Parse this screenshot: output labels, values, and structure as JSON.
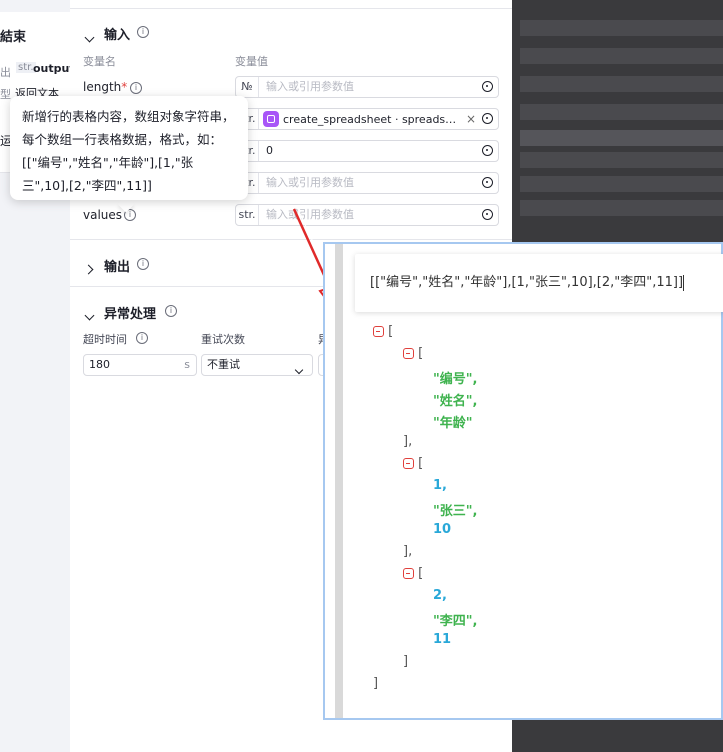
{
  "left_panel": {
    "title": "結束",
    "row1_prefix": "出",
    "row1_type": "str.",
    "row1_name": "output",
    "row2_prefix": "型",
    "row2_text": "返回文本",
    "row3_text": "运行"
  },
  "input_section": {
    "title": "输入",
    "col_name": "变量名",
    "col_value": "变量值",
    "rows": [
      {
        "name": "length",
        "required": "*",
        "type": "№",
        "placeholder": "输入或引用参数值",
        "value": ""
      },
      {
        "name": "",
        "type": "str.",
        "value": "",
        "chip": "create_spreadsheet · spreads…",
        "chip_close": "×"
      },
      {
        "name": "",
        "type": "str.",
        "value": "0"
      },
      {
        "name": "",
        "type": "str.",
        "placeholder": "输入或引用参数值"
      },
      {
        "name": "values",
        "type": "str.",
        "placeholder": "输入或引用参数值"
      }
    ]
  },
  "tooltip": {
    "text": "新增行的表格内容，数组对象字符串，每个数组一行表格数据，格式，如：[[\"编号\",\"姓名\",\"年龄\"],[1,\"张三\",10],[2,\"李四\",11]]"
  },
  "output_section": {
    "title": "输出"
  },
  "exception_section": {
    "title": "异常处理",
    "timeout_label": "超时时间",
    "timeout_value": "180",
    "timeout_unit": "s",
    "retry_label": "重试次数",
    "retry_value": "不重试",
    "third_label": "异"
  },
  "json_viewer": {
    "raw": "[[\"编号\",\"姓名\",\"年龄\"],[1,\"张三\",10],[2,\"李四\",11]]",
    "open_bracket": "[",
    "close_bracket": "]",
    "groups": [
      {
        "items": [
          {
            "text": "\"编号\",",
            "kind": "str"
          },
          {
            "text": "\"姓名\",",
            "kind": "str"
          },
          {
            "text": "\"年龄\"",
            "kind": "str"
          }
        ],
        "close": "],"
      },
      {
        "items": [
          {
            "text": "1,",
            "kind": "num"
          },
          {
            "text": "\"张三\",",
            "kind": "str"
          },
          {
            "text": "10",
            "kind": "num"
          }
        ],
        "close": "],"
      },
      {
        "items": [
          {
            "text": "2,",
            "kind": "num"
          },
          {
            "text": "\"李四\",",
            "kind": "str"
          },
          {
            "text": "11",
            "kind": "num"
          }
        ],
        "close": "]"
      }
    ]
  },
  "colors": {
    "accent_red": "#e0403c",
    "string_green": "#3fb34f",
    "number_blue": "#29a8d8",
    "chip_purple": "#a855f7"
  }
}
